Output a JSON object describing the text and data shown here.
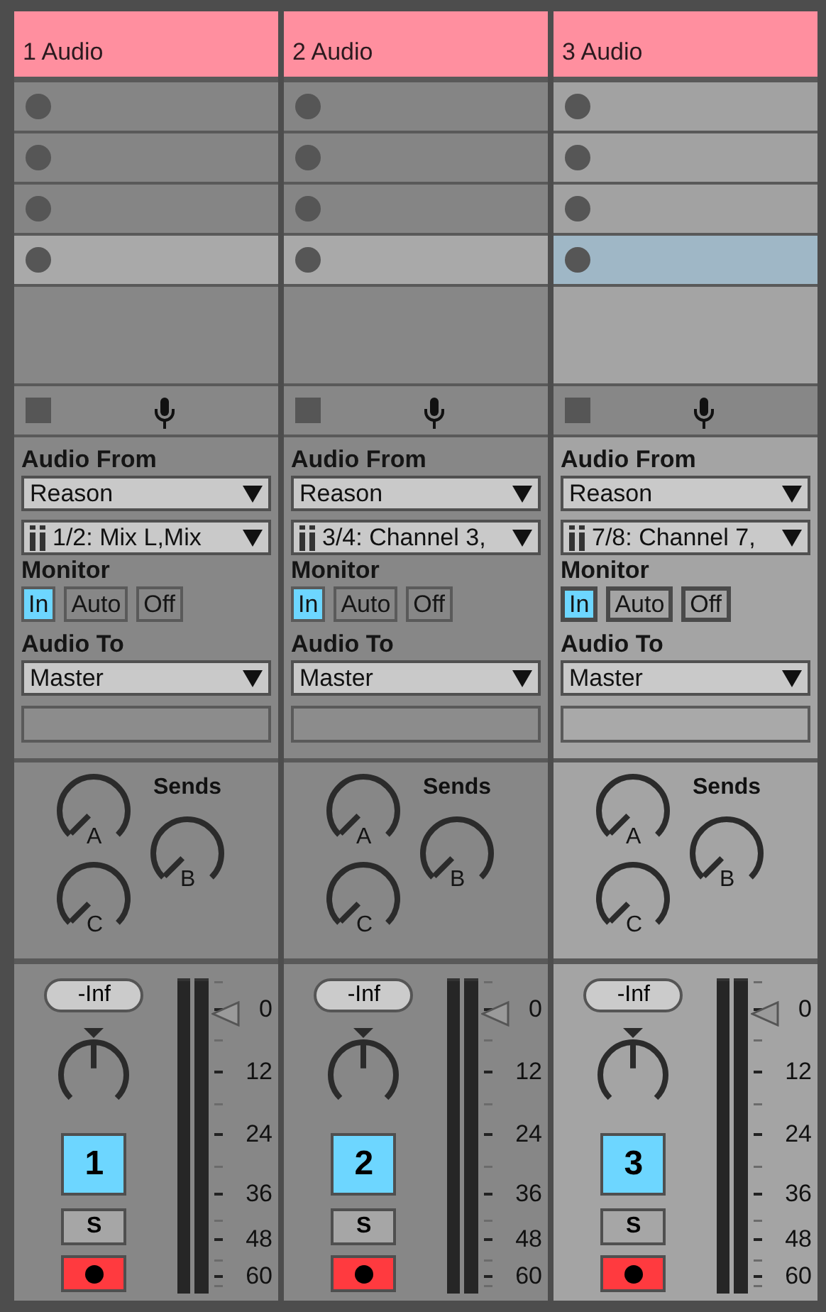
{
  "tracks": [
    {
      "name": "1 Audio",
      "color": "#ff8f9f",
      "selected": false,
      "clip_slots": [
        {
          "selected": false
        },
        {
          "selected": false
        },
        {
          "selected": false
        },
        {
          "selected": true
        }
      ],
      "audio_from": {
        "label": "Audio From",
        "type": "Reason",
        "channel": "1/2: Mix L,Mix"
      },
      "monitor": {
        "label": "Monitor",
        "options": [
          {
            "label": "In",
            "selected": true
          },
          {
            "label": "Auto",
            "selected": false
          },
          {
            "label": "Off",
            "selected": false
          }
        ]
      },
      "audio_to": {
        "label": "Audio To",
        "value": "Master"
      },
      "sends": {
        "title": "Sends",
        "knobs": [
          {
            "label": "A"
          },
          {
            "label": "B"
          },
          {
            "label": "C"
          }
        ]
      },
      "mixer": {
        "peak": "-Inf",
        "activator": {
          "label": "1",
          "on": true
        },
        "solo": {
          "label": "S",
          "on": false
        },
        "arm": {
          "on": true
        },
        "scale": [
          "0",
          "12",
          "24",
          "36",
          "48",
          "60"
        ]
      }
    },
    {
      "name": "2 Audio",
      "color": "#ff8f9f",
      "selected": false,
      "clip_slots": [
        {
          "selected": false
        },
        {
          "selected": false
        },
        {
          "selected": false
        },
        {
          "selected": true
        }
      ],
      "audio_from": {
        "label": "Audio From",
        "type": "Reason",
        "channel": "3/4: Channel 3,"
      },
      "monitor": {
        "label": "Monitor",
        "options": [
          {
            "label": "In",
            "selected": true
          },
          {
            "label": "Auto",
            "selected": false
          },
          {
            "label": "Off",
            "selected": false
          }
        ]
      },
      "audio_to": {
        "label": "Audio To",
        "value": "Master"
      },
      "sends": {
        "title": "Sends",
        "knobs": [
          {
            "label": "A"
          },
          {
            "label": "B"
          },
          {
            "label": "C"
          }
        ]
      },
      "mixer": {
        "peak": "-Inf",
        "activator": {
          "label": "2",
          "on": true
        },
        "solo": {
          "label": "S",
          "on": false
        },
        "arm": {
          "on": true
        },
        "scale": [
          "0",
          "12",
          "24",
          "36",
          "48",
          "60"
        ]
      }
    },
    {
      "name": "3 Audio",
      "color": "#ff8f9f",
      "selected": true,
      "clip_slots": [
        {
          "selected": false
        },
        {
          "selected": false
        },
        {
          "selected": false
        },
        {
          "selected": true
        }
      ],
      "audio_from": {
        "label": "Audio From",
        "type": "Reason",
        "channel": "7/8: Channel 7,"
      },
      "monitor": {
        "label": "Monitor",
        "options": [
          {
            "label": "In",
            "selected": true
          },
          {
            "label": "Auto",
            "selected": false
          },
          {
            "label": "Off",
            "selected": false
          }
        ]
      },
      "audio_to": {
        "label": "Audio To",
        "value": "Master"
      },
      "sends": {
        "title": "Sends",
        "knobs": [
          {
            "label": "A"
          },
          {
            "label": "B"
          },
          {
            "label": "C"
          }
        ]
      },
      "mixer": {
        "peak": "-Inf",
        "activator": {
          "label": "3",
          "on": true
        },
        "solo": {
          "label": "S",
          "on": false
        },
        "arm": {
          "on": true
        },
        "scale": [
          "0",
          "12",
          "24",
          "36",
          "48",
          "60"
        ]
      }
    }
  ]
}
